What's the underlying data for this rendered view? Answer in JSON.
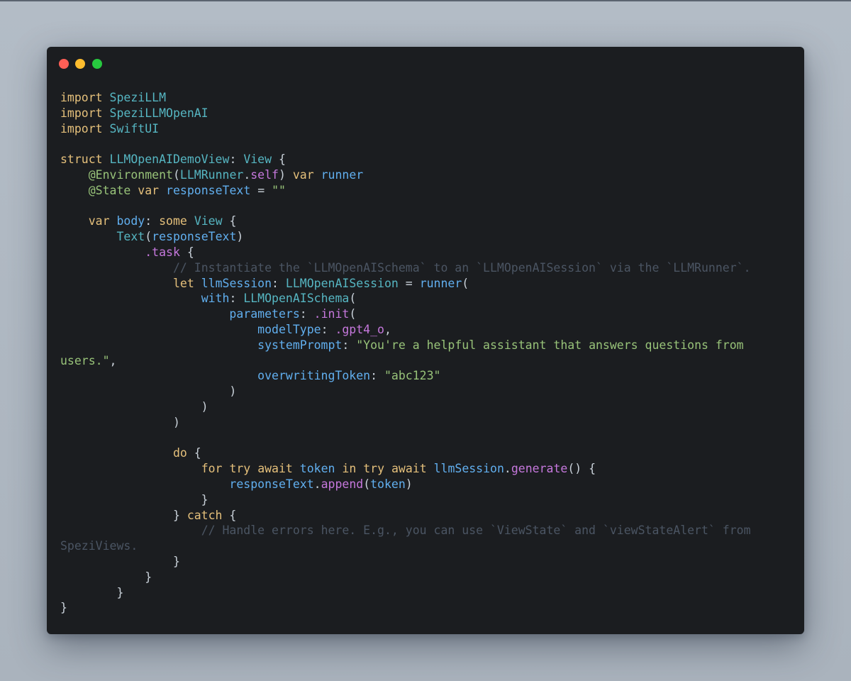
{
  "colors": {
    "background": "#b3bcc6",
    "window": "#1b1d20",
    "close": "#ff5f56",
    "minimize": "#ffbd2e",
    "zoom": "#27c93f",
    "keyword": "#e5c07b",
    "type": "#56b6c2",
    "identifier": "#61afef",
    "attribute": "#98c379",
    "member": "#c678dd",
    "string": "#98c379",
    "comment": "#4b5563",
    "plain": "#c9d1d9"
  },
  "window": {
    "buttons": [
      {
        "name": "close",
        "icon": "red-circle"
      },
      {
        "name": "minimize",
        "icon": "yellow-circle"
      },
      {
        "name": "zoom",
        "icon": "green-circle"
      }
    ]
  },
  "code": {
    "language": "swift",
    "lines": [
      [
        {
          "t": "import",
          "k": "kw"
        },
        {
          "t": " "
        },
        {
          "t": "SpeziLLM",
          "k": "ty"
        }
      ],
      [
        {
          "t": "import",
          "k": "kw"
        },
        {
          "t": " "
        },
        {
          "t": "SpeziLLMOpenAI",
          "k": "ty"
        }
      ],
      [
        {
          "t": "import",
          "k": "kw"
        },
        {
          "t": " "
        },
        {
          "t": "SwiftUI",
          "k": "ty"
        }
      ],
      [],
      [
        {
          "t": "struct",
          "k": "kw"
        },
        {
          "t": " "
        },
        {
          "t": "LLMOpenAIDemoView",
          "k": "ty"
        },
        {
          "t": ": "
        },
        {
          "t": "View",
          "k": "ty"
        },
        {
          "t": " {"
        }
      ],
      [
        {
          "t": "    "
        },
        {
          "t": "@Environment",
          "k": "attr"
        },
        {
          "t": "("
        },
        {
          "t": "LLMRunner",
          "k": "ty"
        },
        {
          "t": "."
        },
        {
          "t": "self",
          "k": "mem"
        },
        {
          "t": ") "
        },
        {
          "t": "var",
          "k": "kw"
        },
        {
          "t": " "
        },
        {
          "t": "runner",
          "k": "id"
        }
      ],
      [
        {
          "t": "    "
        },
        {
          "t": "@State",
          "k": "attr"
        },
        {
          "t": " "
        },
        {
          "t": "var",
          "k": "kw"
        },
        {
          "t": " "
        },
        {
          "t": "responseText",
          "k": "id"
        },
        {
          "t": " = "
        },
        {
          "t": "\"\"",
          "k": "str"
        }
      ],
      [],
      [
        {
          "t": "    "
        },
        {
          "t": "var",
          "k": "kw"
        },
        {
          "t": " "
        },
        {
          "t": "body",
          "k": "id"
        },
        {
          "t": ": "
        },
        {
          "t": "some",
          "k": "kw"
        },
        {
          "t": " "
        },
        {
          "t": "View",
          "k": "ty"
        },
        {
          "t": " {"
        }
      ],
      [
        {
          "t": "        "
        },
        {
          "t": "Text",
          "k": "ty"
        },
        {
          "t": "("
        },
        {
          "t": "responseText",
          "k": "id"
        },
        {
          "t": ")"
        }
      ],
      [
        {
          "t": "            "
        },
        {
          "t": ".task",
          "k": "mem"
        },
        {
          "t": " {"
        }
      ],
      [
        {
          "t": "                "
        },
        {
          "t": "// Instantiate the `LLMOpenAISchema` to an `LLMOpenAISession` via the `LLMRunner`.",
          "k": "cm"
        }
      ],
      [
        {
          "t": "                "
        },
        {
          "t": "let",
          "k": "kw"
        },
        {
          "t": " "
        },
        {
          "t": "llmSession",
          "k": "id"
        },
        {
          "t": ": "
        },
        {
          "t": "LLMOpenAISession",
          "k": "ty"
        },
        {
          "t": " = "
        },
        {
          "t": "runner",
          "k": "id"
        },
        {
          "t": "("
        }
      ],
      [
        {
          "t": "                    "
        },
        {
          "t": "with",
          "k": "id"
        },
        {
          "t": ": "
        },
        {
          "t": "LLMOpenAISchema",
          "k": "ty"
        },
        {
          "t": "("
        }
      ],
      [
        {
          "t": "                        "
        },
        {
          "t": "parameters",
          "k": "id"
        },
        {
          "t": ": "
        },
        {
          "t": ".init",
          "k": "mem"
        },
        {
          "t": "("
        }
      ],
      [
        {
          "t": "                            "
        },
        {
          "t": "modelType",
          "k": "id"
        },
        {
          "t": ": "
        },
        {
          "t": ".gpt4_o",
          "k": "mem"
        },
        {
          "t": ","
        }
      ],
      [
        {
          "t": "                            "
        },
        {
          "t": "systemPrompt",
          "k": "id"
        },
        {
          "t": ": "
        },
        {
          "t": "\"You're a helpful assistant that answers questions from",
          "k": "str"
        }
      ],
      [
        {
          "t": "users.\"",
          "k": "str"
        },
        {
          "t": ","
        }
      ],
      [
        {
          "t": "                            "
        },
        {
          "t": "overwritingToken",
          "k": "id"
        },
        {
          "t": ": "
        },
        {
          "t": "\"abc123\"",
          "k": "str"
        }
      ],
      [
        {
          "t": "                        )"
        }
      ],
      [
        {
          "t": "                    )"
        }
      ],
      [
        {
          "t": "                )"
        }
      ],
      [],
      [
        {
          "t": "                "
        },
        {
          "t": "do",
          "k": "kw"
        },
        {
          "t": " {"
        }
      ],
      [
        {
          "t": "                    "
        },
        {
          "t": "for",
          "k": "kw"
        },
        {
          "t": " "
        },
        {
          "t": "try",
          "k": "kw"
        },
        {
          "t": " "
        },
        {
          "t": "await",
          "k": "kw"
        },
        {
          "t": " "
        },
        {
          "t": "token",
          "k": "id"
        },
        {
          "t": " "
        },
        {
          "t": "in",
          "k": "kw"
        },
        {
          "t": " "
        },
        {
          "t": "try",
          "k": "kw"
        },
        {
          "t": " "
        },
        {
          "t": "await",
          "k": "kw"
        },
        {
          "t": " "
        },
        {
          "t": "llmSession",
          "k": "id"
        },
        {
          "t": "."
        },
        {
          "t": "generate",
          "k": "mem"
        },
        {
          "t": "() {"
        }
      ],
      [
        {
          "t": "                        "
        },
        {
          "t": "responseText",
          "k": "id"
        },
        {
          "t": "."
        },
        {
          "t": "append",
          "k": "mem"
        },
        {
          "t": "("
        },
        {
          "t": "token",
          "k": "id"
        },
        {
          "t": ")"
        }
      ],
      [
        {
          "t": "                    }"
        }
      ],
      [
        {
          "t": "                } "
        },
        {
          "t": "catch",
          "k": "kw"
        },
        {
          "t": " {"
        }
      ],
      [
        {
          "t": "                    "
        },
        {
          "t": "// Handle errors here. E.g., you can use `ViewState` and `viewStateAlert` from",
          "k": "cm"
        }
      ],
      [
        {
          "t": "SpeziViews.",
          "k": "cm"
        }
      ],
      [
        {
          "t": "                }"
        }
      ],
      [
        {
          "t": "            }"
        }
      ],
      [
        {
          "t": "        }"
        }
      ],
      [
        {
          "t": "}"
        }
      ]
    ]
  }
}
